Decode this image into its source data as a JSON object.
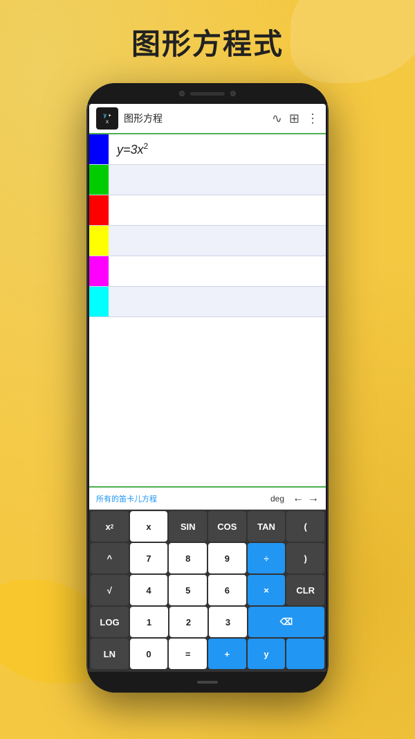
{
  "page": {
    "title": "图形方程式",
    "background_color": "#F5C842"
  },
  "app": {
    "header": {
      "logo_top": "y",
      "logo_bottom": "x",
      "logo_plus": "+",
      "title": "图形方程",
      "icons": {
        "wave": "∿",
        "grid": "⊞",
        "more": "⋮"
      }
    },
    "equations": [
      {
        "color": "#0000FF",
        "text": "y=3x²",
        "superscript": "2"
      },
      {
        "color": "#00CC00",
        "text": ""
      },
      {
        "color": "#FF0000",
        "text": ""
      },
      {
        "color": "#FFFF00",
        "text": ""
      },
      {
        "color": "#FF00FF",
        "text": ""
      },
      {
        "color": "#00FFFF",
        "text": ""
      }
    ],
    "bottom_bar": {
      "text": "所有的笛卡儿方程",
      "deg": "deg",
      "arrow_left": "←",
      "arrow_right": "→"
    },
    "keyboard": {
      "rows": [
        [
          {
            "label": "x²",
            "style": "dark"
          },
          {
            "label": "x",
            "style": "white"
          },
          {
            "label": "SIN",
            "style": "dark"
          },
          {
            "label": "COS",
            "style": "dark"
          },
          {
            "label": "TAN",
            "style": "dark"
          },
          {
            "label": "(",
            "style": "dark"
          }
        ],
        [
          {
            "label": "^",
            "style": "dark"
          },
          {
            "label": "7",
            "style": "white"
          },
          {
            "label": "8",
            "style": "white"
          },
          {
            "label": "9",
            "style": "white"
          },
          {
            "label": "÷",
            "style": "blue"
          },
          {
            "label": ")",
            "style": "dark"
          }
        ],
        [
          {
            "label": "√",
            "style": "dark"
          },
          {
            "label": "4",
            "style": "white"
          },
          {
            "label": "5",
            "style": "white"
          },
          {
            "label": "6",
            "style": "white"
          },
          {
            "label": "×",
            "style": "blue"
          },
          {
            "label": "CLR",
            "style": "dark"
          }
        ],
        [
          {
            "label": "LOG",
            "style": "dark"
          },
          {
            "label": "1",
            "style": "white"
          },
          {
            "label": "2",
            "style": "white"
          },
          {
            "label": "3",
            "style": "white"
          },
          {
            "label": "⌫",
            "style": "blue"
          },
          {
            "label": "",
            "style": "blue",
            "is_backspace": true
          }
        ],
        [
          {
            "label": "LN",
            "style": "dark"
          },
          {
            "label": "0",
            "style": "white"
          },
          {
            "label": "=",
            "style": "white"
          },
          {
            "label": "+",
            "style": "blue"
          },
          {
            "label": "y",
            "style": "blue"
          },
          {
            "label": "",
            "style": "blue"
          }
        ]
      ]
    }
  }
}
